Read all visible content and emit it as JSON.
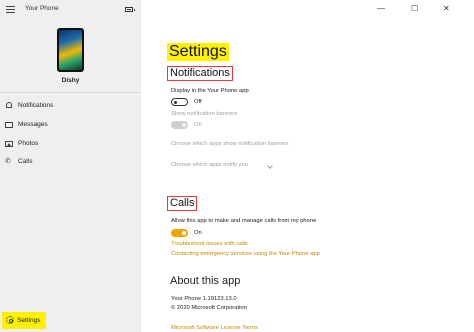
{
  "app": {
    "title": "Your Phone"
  },
  "device": {
    "name": "Dishy"
  },
  "sidebar": {
    "items": [
      {
        "label": "Notifications",
        "icon": "bell-icon"
      },
      {
        "label": "Messages",
        "icon": "message-icon"
      },
      {
        "label": "Photos",
        "icon": "photo-icon"
      },
      {
        "label": "Calls",
        "icon": "phone-icon"
      }
    ],
    "settings_label": "Settings"
  },
  "window": {
    "minimize": "—",
    "maximize": "☐",
    "close": "✕"
  },
  "main": {
    "title": "Settings",
    "notifications": {
      "heading": "Notifications",
      "display_label": "Display in the Your Phone app",
      "display_state": "Off",
      "banners_label": "Show notification banners",
      "banners_state": "On",
      "which_apps_banners": "Choose which apps show notification banners",
      "which_apps_notify": "Choose which apps notify you"
    },
    "calls": {
      "heading": "Calls",
      "allow_label": "Allow this app to make and manage calls from my phone",
      "allow_state": "On",
      "link_troubleshoot": "Troubleshoot issues with calls",
      "link_emergency": "Contacting emergency services using the Your Phone app"
    },
    "about": {
      "heading": "About this app",
      "version": "Your Phone 1.19123.13.0",
      "copyright": "© 2020 Microsoft Corporation",
      "license_link": "Microsoft Software License Terms"
    }
  },
  "colors": {
    "highlight": "#fff200",
    "accent": "#f0a500",
    "annotation_box": "#e23b3b"
  }
}
